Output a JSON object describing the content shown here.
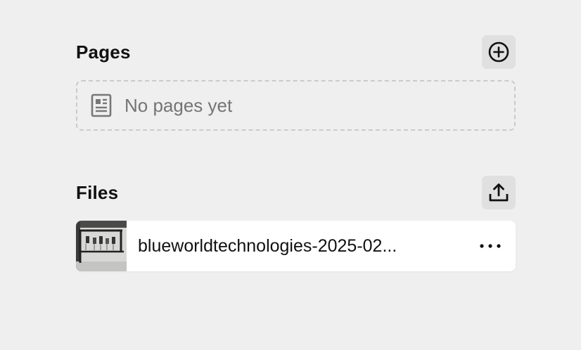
{
  "pages": {
    "title": "Pages",
    "add_icon": "plus-circle-icon",
    "empty_icon": "document-icon",
    "empty_text": "No pages yet"
  },
  "files": {
    "title": "Files",
    "upload_icon": "upload-icon",
    "items": [
      {
        "name": "blueworldtechnologies-2025-02...",
        "thumbnail": "equipment-rack-photo",
        "menu_icon": "more-horizontal-icon"
      }
    ]
  },
  "colors": {
    "background": "#efefef",
    "button_bg": "#e0e0e0",
    "muted_text": "#747474",
    "dashed_border": "#cacaca",
    "card_bg": "#ffffff"
  }
}
